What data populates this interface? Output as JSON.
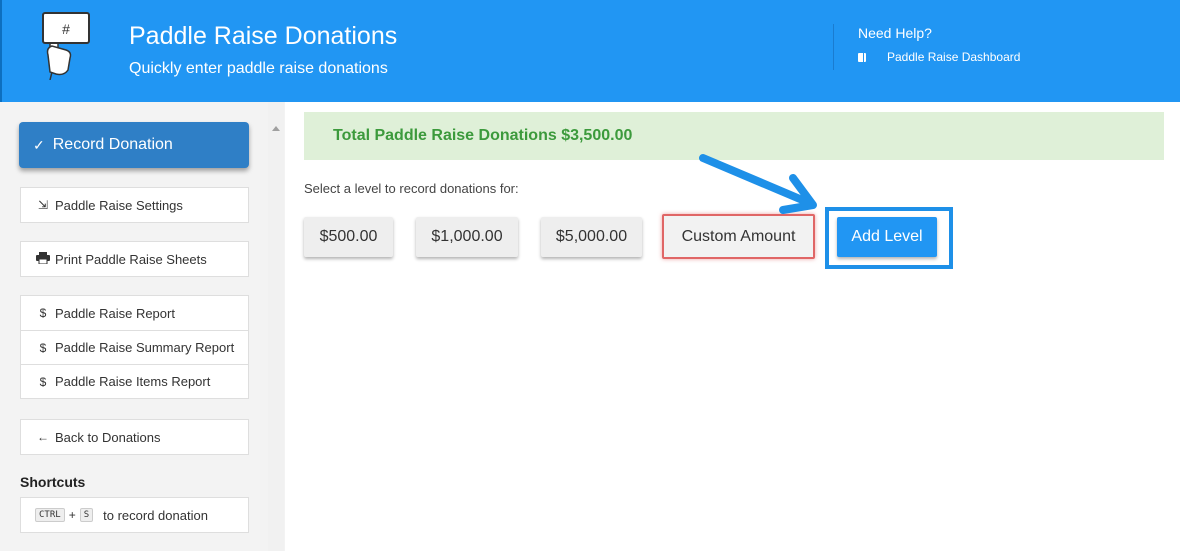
{
  "header": {
    "logo_symbol": "#",
    "title": "Paddle Raise Donations",
    "subtitle": "Quickly enter paddle raise donations",
    "help_title": "Need Help?",
    "help_link": "Paddle Raise Dashboard",
    "help_link_icon": "book-icon"
  },
  "sidebar": {
    "record_button": "Record Donation",
    "settings": "Paddle Raise Settings",
    "print": "Print Paddle Raise Sheets",
    "reports": [
      "Paddle Raise Report",
      "Paddle Raise Summary Report",
      "Paddle Raise Items Report"
    ],
    "back": "Back to Donations",
    "shortcuts_label": "Shortcuts",
    "shortcut": {
      "key1": "CTRL",
      "plus": "+",
      "key2": "S",
      "text": "to record donation"
    }
  },
  "main": {
    "total_banner": "Total Paddle Raise Donations $3,500.00",
    "select_label": "Select a level to record donations for:",
    "levels": [
      "$500.00",
      "$1,000.00",
      "$5,000.00"
    ],
    "custom_amount": "Custom Amount",
    "add_level": "Add Level"
  },
  "colors": {
    "header_bg": "#2196f3",
    "record_btn_bg": "#2f7fc6",
    "banner_bg": "#dff0d8",
    "banner_text": "#3c9a3c",
    "custom_border": "#e06666",
    "highlight": "#1e90e8"
  }
}
